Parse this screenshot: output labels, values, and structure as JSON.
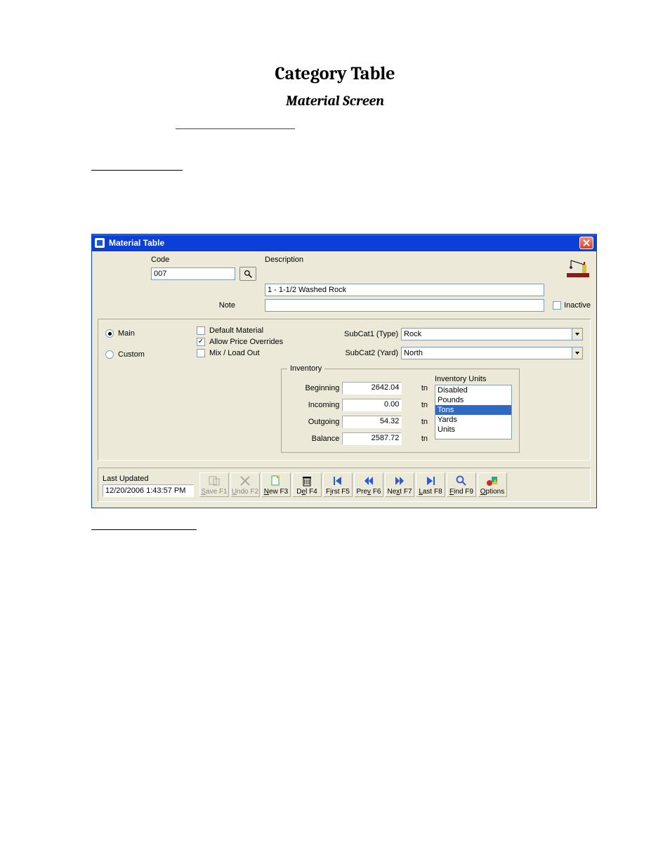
{
  "doc": {
    "title": "Category Table",
    "subtitle": "Material Screen"
  },
  "window": {
    "title": "Material Table",
    "code_label": "Code",
    "code_value": "007",
    "description_label": "Description",
    "description_value": "1 - 1-1/2 Washed Rock",
    "note_label": "Note",
    "note_value": "",
    "inactive_label": "Inactive",
    "inactive_checked": false
  },
  "radios": {
    "main": "Main",
    "custom": "Custom",
    "selected": "main"
  },
  "options": {
    "default_material": {
      "label": "Default Material",
      "checked": false
    },
    "allow_price_overrides": {
      "label": "Allow Price Overrides",
      "checked": true
    },
    "mix_load_out": {
      "label": "Mix / Load Out",
      "checked": false
    }
  },
  "subcat": {
    "label1": "SubCat1 (Type)",
    "value1": "Rock",
    "label2": "SubCat2 (Yard)",
    "value2": "North"
  },
  "inventory": {
    "legend": "Inventory",
    "unit_abbr": "tn",
    "beginning": {
      "label": "Beginning",
      "value": "2642.04"
    },
    "incoming": {
      "label": "Incoming",
      "value": "0.00"
    },
    "outgoing": {
      "label": "Outgoing",
      "value": "54.32"
    },
    "balance": {
      "label": "Balance",
      "value": "2587.72"
    },
    "units_label": "Inventory Units",
    "units_items": [
      "Disabled",
      "Pounds",
      "Tons",
      "Yards",
      "Units"
    ],
    "units_selected": "Tons"
  },
  "footer": {
    "last_updated_label": "Last Updated",
    "last_updated_value": "12/20/2006 1:43:57 PM"
  },
  "toolbar": {
    "save": "Save F1",
    "undo": "Undo F2",
    "new": "New F3",
    "del": "Del F4",
    "first": "First F5",
    "prev": "Prev F6",
    "next": "Next F7",
    "last": "Last F8",
    "find": "Find F9",
    "options": "Options"
  }
}
